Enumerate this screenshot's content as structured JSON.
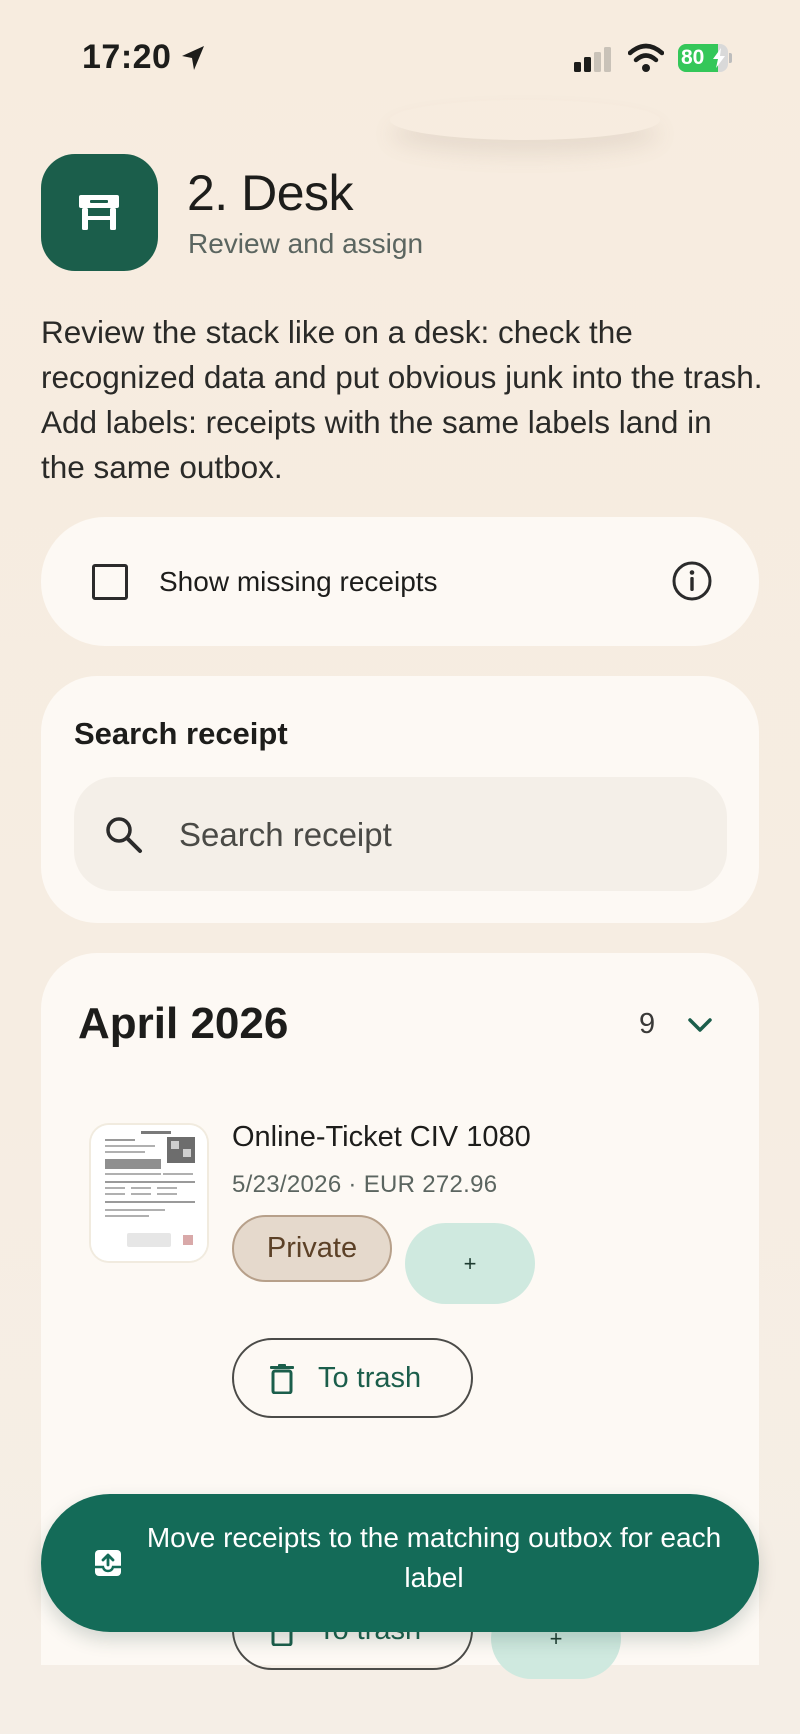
{
  "status_bar": {
    "time": "17:20",
    "battery_percent": 80,
    "battery_text": "80",
    "icons": [
      "location-arrow-icon",
      "cellular-signal-icon",
      "wifi-icon",
      "battery-charging-icon"
    ]
  },
  "header": {
    "title": "2. Desk",
    "subtitle": "Review and assign",
    "icon": "desk-icon",
    "tile_color": "#1b5e4b"
  },
  "intro": {
    "text": "Review the stack like on a desk: check the recognized data and put obvious junk into the trash. Add labels: receipts with the same labels land in the same outbox."
  },
  "missing_receipts": {
    "label": "Show missing receipts",
    "checked": false
  },
  "search": {
    "heading": "Search receipt",
    "placeholder": "Search receipt",
    "value": ""
  },
  "month_group": {
    "title": "April 2026",
    "count": "9",
    "receipts": [
      {
        "title": "Online-Ticket CIV 1080",
        "meta": "5/23/2026 · EUR 272.96",
        "label": "Private",
        "add_label": "+",
        "trash_label": "To trash"
      },
      {
        "add_label": "+",
        "trash_label": "To trash"
      }
    ]
  },
  "cta": {
    "label": "Move receipts to the matching outbox for each label",
    "color": "#146b58"
  }
}
